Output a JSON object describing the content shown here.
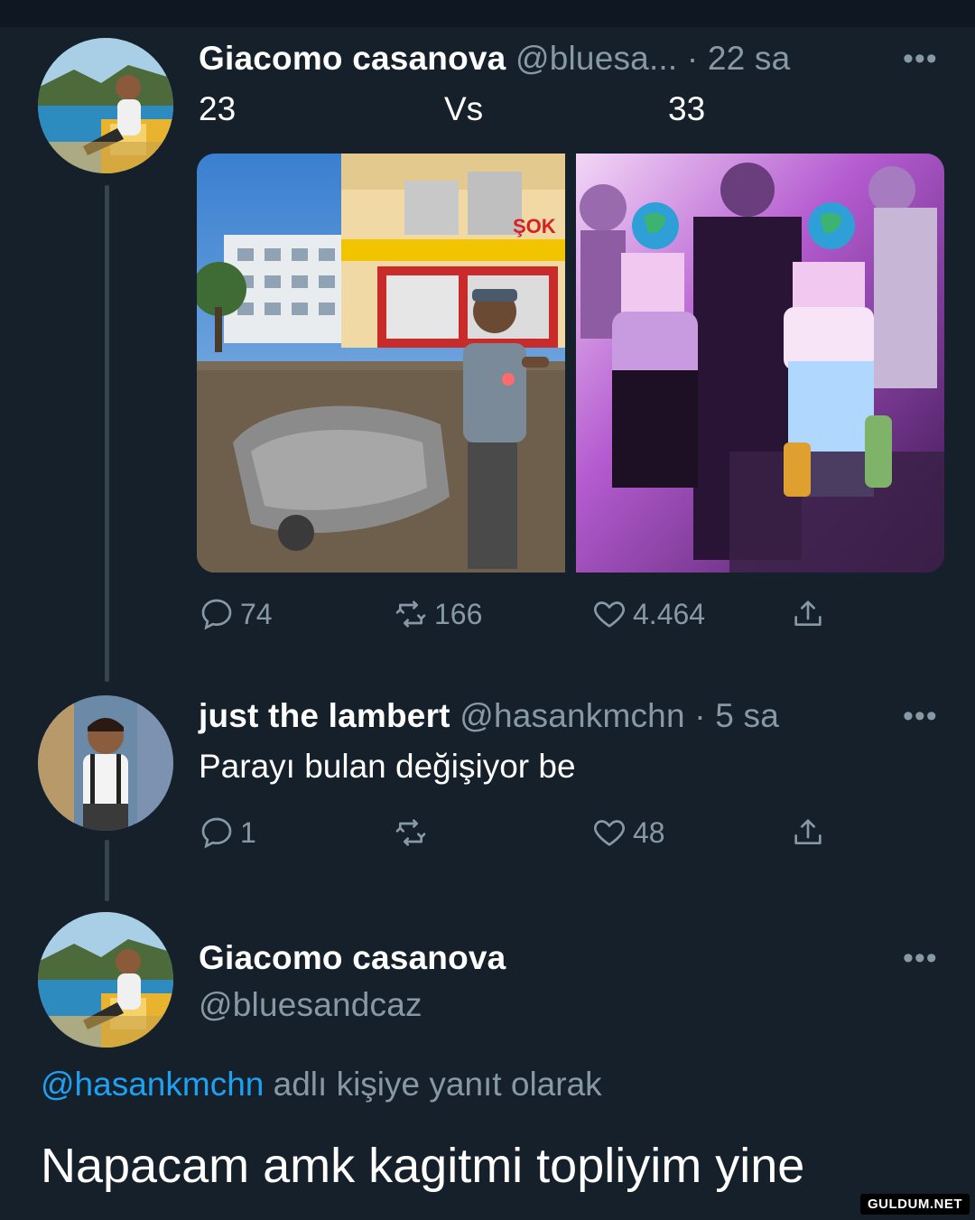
{
  "tweet1": {
    "name": "Giacomo casanova",
    "handle": "@bluesa...",
    "time": "· 22 sa",
    "more": "•••",
    "text": {
      "left": "23",
      "middle": "Vs",
      "right": "33"
    },
    "actions": {
      "replies": "74",
      "retweets": "166",
      "likes": "4.464"
    },
    "avatar_icon": "avatar-photo-icon"
  },
  "tweet2": {
    "name": "just the lambert",
    "handle": "@hasankmchn",
    "time": "· 5 sa",
    "more": "•••",
    "text": "Parayı bulan değişiyor be",
    "actions": {
      "replies": "1",
      "retweets": "",
      "likes": "48"
    },
    "avatar_icon": "avatar-photo-icon"
  },
  "tweet3": {
    "name": "Giacomo casanova",
    "handle": "@bluesandcaz",
    "more": "•••",
    "reply_mention": "@hasankmchn",
    "reply_suffix": "adlı kişiye yanıt olarak",
    "text": "Napacam amk kagitmi topliyim yine"
  },
  "watermark": "GULDUM.NET",
  "colors": {
    "background": "#15202b",
    "muted": "#8899a6",
    "link": "#1da1f2",
    "thread_line": "#38444d"
  }
}
